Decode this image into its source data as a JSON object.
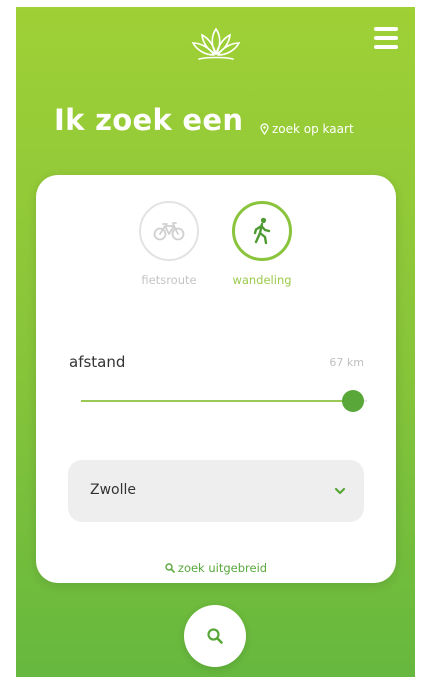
{
  "header": {
    "logo_icon": "lotus-logo-icon",
    "menu_icon": "hamburger-menu-icon"
  },
  "heading": "Ik zoek een",
  "map_link": {
    "icon": "map-pin-icon",
    "label": "zoek op kaart"
  },
  "modes": [
    {
      "label": "fietsroute",
      "icon": "bicycle-icon",
      "selected": false
    },
    {
      "label": "wandeling",
      "icon": "walking-person-icon",
      "selected": true
    }
  ],
  "distance": {
    "label": "afstand",
    "value_text": "67 km",
    "slider_fraction": 0.95
  },
  "location_select": {
    "value": "Zwolle",
    "icon": "chevron-down-icon"
  },
  "advanced_link": {
    "icon": "search-icon",
    "label": "zoek uitgebreid"
  },
  "search_button": {
    "icon": "search-icon"
  },
  "colors": {
    "background_top": "#9fd036",
    "background_bottom": "#66b83e",
    "accent": "#58a738",
    "inactive": "#c4c4c4"
  }
}
